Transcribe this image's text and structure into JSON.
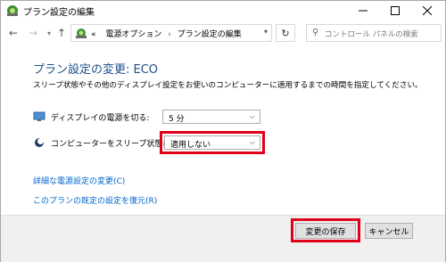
{
  "window": {
    "title": "プラン設定の編集"
  },
  "addressbar": {
    "overflow": "«",
    "crumb1": "電源オプション",
    "separator": "›",
    "crumb2": "プラン設定の編集",
    "search_placeholder": "コントロール パネルの検索"
  },
  "main": {
    "heading": "プラン設定の変更: ECO",
    "description": "スリープ状態やその他のディスプレイ設定をお使いのコンピューターに適用するまでの時間を指定してください。",
    "display_off_label": "ディスプレイの電源を切る:",
    "display_off_value": "5 分",
    "sleep_label": "コンピューターをスリープ状態にする:",
    "sleep_value": "適用しない",
    "link_advanced": "詳細な電源設定の変更(C)",
    "link_restore": "このプランの既定の設定を復元(R)"
  },
  "footer": {
    "save": "変更の保存",
    "cancel": "キャンセル"
  },
  "colors": {
    "accent": "#1e4e8c",
    "link": "#0066cc",
    "highlight": "#e0001a"
  }
}
